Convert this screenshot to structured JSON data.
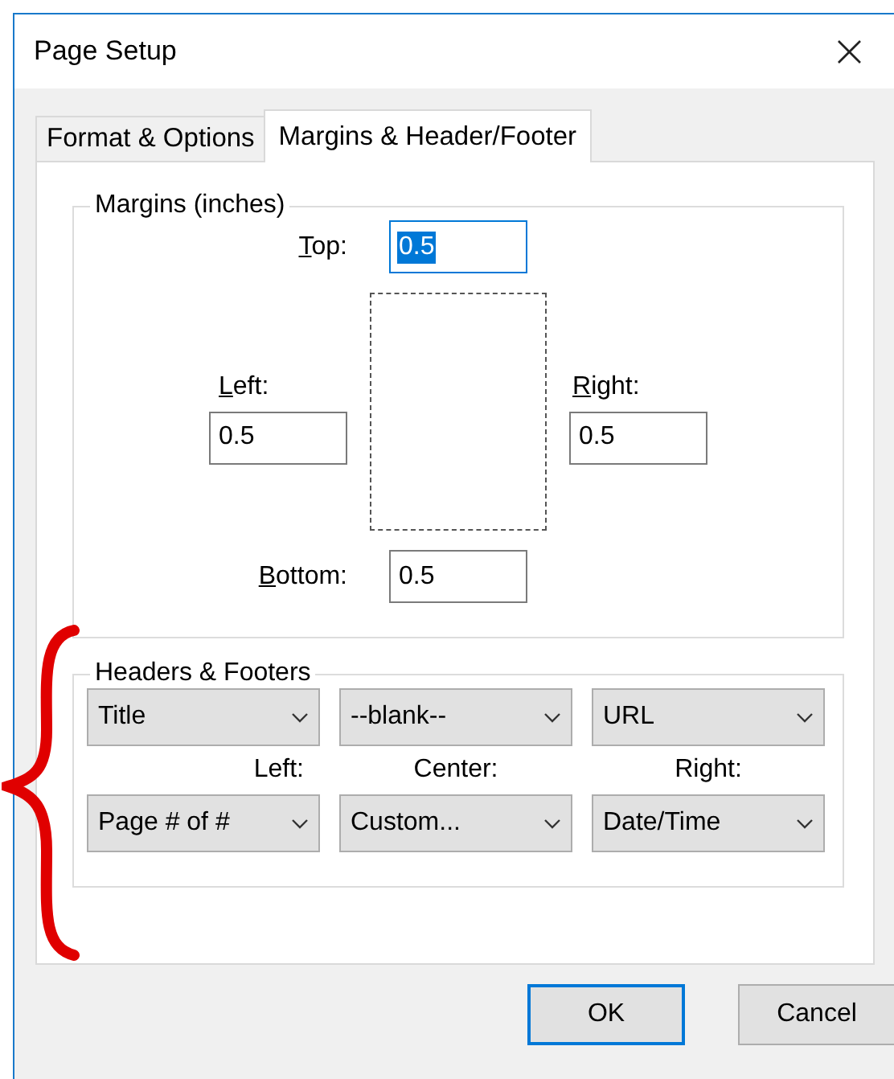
{
  "window": {
    "title": "Page Setup",
    "close": "×"
  },
  "tabs": [
    {
      "label": "Format & Options",
      "selected": false
    },
    {
      "label": "Margins & Header/Footer",
      "selected": true
    }
  ],
  "margins": {
    "title": "Margins (inches)",
    "top": {
      "label": "Top:",
      "value": "0.5",
      "highlighted": true
    },
    "left": {
      "label": "Left:",
      "value": "0.5",
      "highlighted": false
    },
    "right": {
      "label": "Right:",
      "value": "0.5",
      "highlighted": false
    },
    "bottom": {
      "label": "Bottom:",
      "value": "0.5",
      "highlighted": false
    }
  },
  "headers_footers": {
    "title": "Headers & Footers",
    "header": [
      "Title",
      "--blank--",
      "URL"
    ],
    "labels": [
      "Left:",
      "Center:",
      "Right:"
    ],
    "footer": [
      "Page # of #",
      "Custom...",
      "Date/Time"
    ]
  },
  "buttons": [
    {
      "label": "OK",
      "default": true
    },
    {
      "label": "Cancel",
      "default": false
    }
  ]
}
